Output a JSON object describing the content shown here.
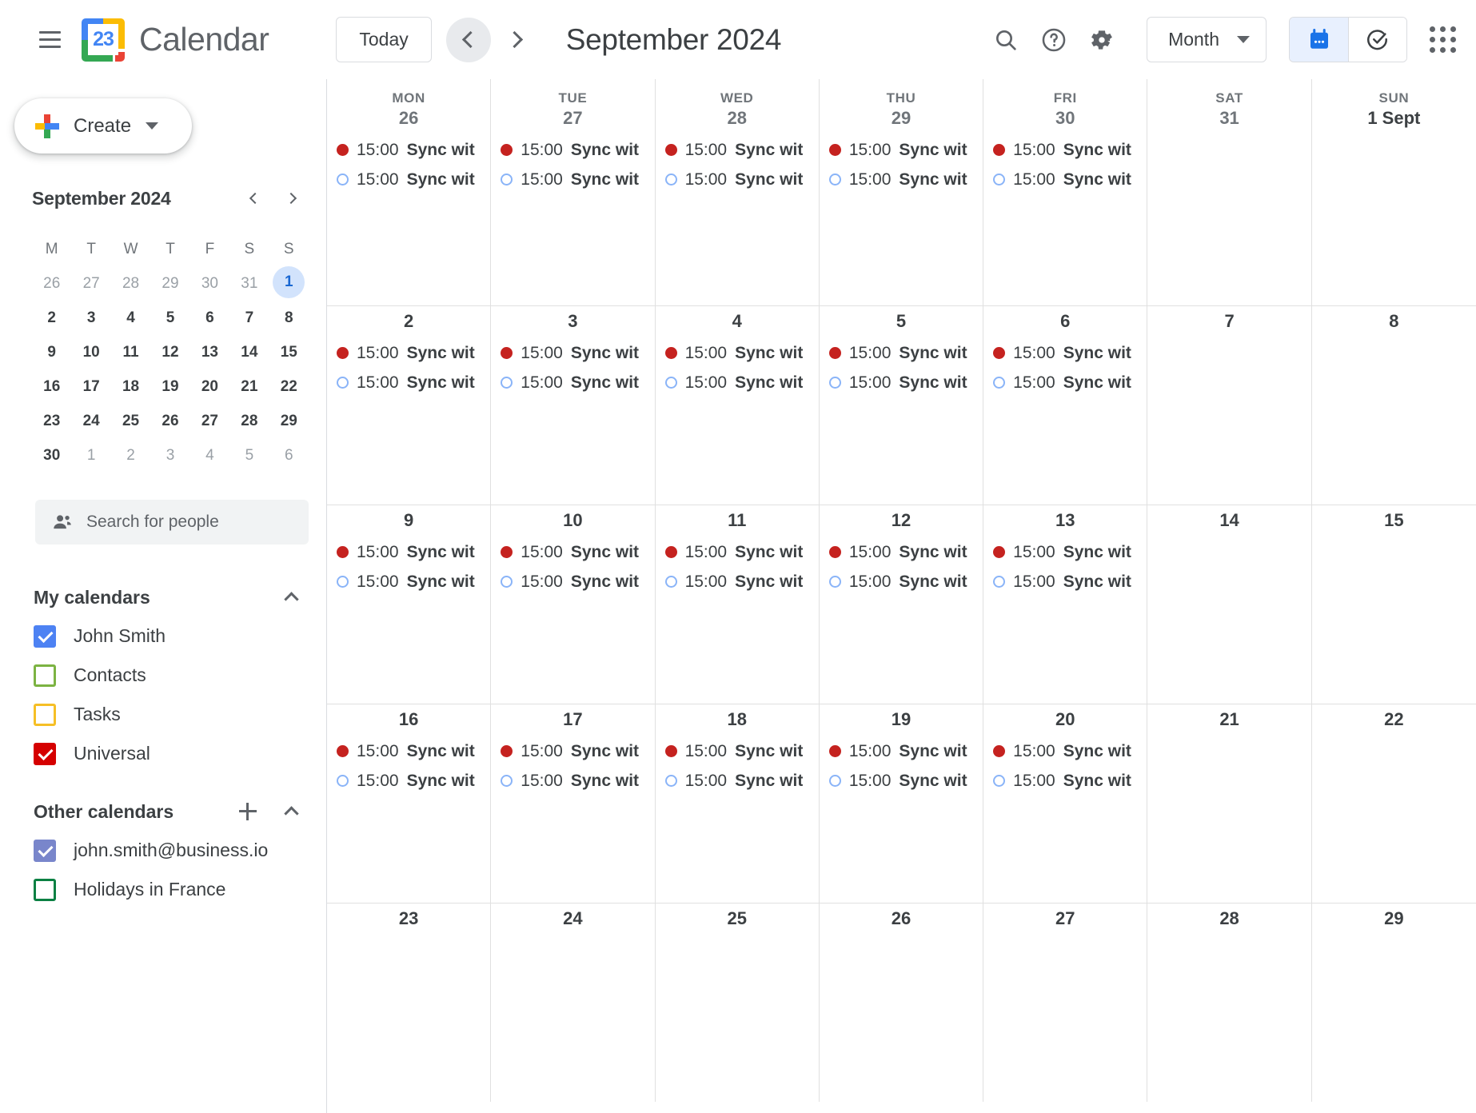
{
  "app": {
    "brand_title": "Calendar",
    "logo_day": "23"
  },
  "toolbar": {
    "menu_icon": "hamburger-menu-icon",
    "today_label": "Today",
    "prev_label": "chevron-left-icon",
    "next_label": "chevron-right-icon",
    "period_title": "September 2024",
    "search_icon": "search-icon",
    "help_icon": "help-circle-icon",
    "settings_icon": "gear-icon",
    "view_label": "Month",
    "calendar_toggle_icon": "calendar-icon",
    "tasks_toggle_icon": "check-circle-icon",
    "apps_icon": "apps-grid-icon"
  },
  "sidebar": {
    "create_label": "Create",
    "mini_calendar": {
      "title": "September 2024",
      "dow": [
        "M",
        "T",
        "W",
        "T",
        "F",
        "S",
        "S"
      ],
      "weeks": [
        [
          {
            "n": "26",
            "muted": true
          },
          {
            "n": "27",
            "muted": true
          },
          {
            "n": "28",
            "muted": true
          },
          {
            "n": "29",
            "muted": true
          },
          {
            "n": "30",
            "muted": true
          },
          {
            "n": "31",
            "muted": true
          },
          {
            "n": "1",
            "muted": false,
            "today": true
          }
        ],
        [
          {
            "n": "2"
          },
          {
            "n": "3"
          },
          {
            "n": "4"
          },
          {
            "n": "5"
          },
          {
            "n": "6"
          },
          {
            "n": "7"
          },
          {
            "n": "8"
          }
        ],
        [
          {
            "n": "9"
          },
          {
            "n": "10"
          },
          {
            "n": "11"
          },
          {
            "n": "12"
          },
          {
            "n": "13"
          },
          {
            "n": "14"
          },
          {
            "n": "15"
          }
        ],
        [
          {
            "n": "16"
          },
          {
            "n": "17"
          },
          {
            "n": "18"
          },
          {
            "n": "19"
          },
          {
            "n": "20"
          },
          {
            "n": "21"
          },
          {
            "n": "22"
          }
        ],
        [
          {
            "n": "23"
          },
          {
            "n": "24"
          },
          {
            "n": "25"
          },
          {
            "n": "26"
          },
          {
            "n": "27"
          },
          {
            "n": "28"
          },
          {
            "n": "29"
          }
        ],
        [
          {
            "n": "30"
          },
          {
            "n": "1",
            "muted": true
          },
          {
            "n": "2",
            "muted": true
          },
          {
            "n": "3",
            "muted": true
          },
          {
            "n": "4",
            "muted": true
          },
          {
            "n": "5",
            "muted": true
          },
          {
            "n": "6",
            "muted": true
          }
        ]
      ]
    },
    "people_search_placeholder": "Search for people",
    "my_calendars": {
      "title": "My calendars",
      "items": [
        {
          "label": "John Smith",
          "color": "#4d82f3",
          "checked": true
        },
        {
          "label": "Contacts",
          "color": "#7cb342",
          "checked": false
        },
        {
          "label": "Tasks",
          "color": "#f6bf26",
          "checked": false
        },
        {
          "label": "Universal",
          "color": "#d50000",
          "checked": true
        }
      ]
    },
    "other_calendars": {
      "title": "Other calendars",
      "items": [
        {
          "label": "john.smith@business.io",
          "color": "#7986cb",
          "checked": true
        },
        {
          "label": "Holidays in France",
          "color": "#0b8043",
          "checked": false
        }
      ]
    }
  },
  "calendar_grid": {
    "day_headers": [
      "MON",
      "TUE",
      "WED",
      "THU",
      "FRI",
      "SAT",
      "SUN"
    ],
    "event_time": "15:00",
    "event_title": "Sync wit",
    "weeks": [
      {
        "days": [
          {
            "num": "26",
            "muted": true,
            "events": [
              {
                "style": "filled"
              },
              {
                "style": "hollow"
              }
            ]
          },
          {
            "num": "27",
            "muted": true,
            "events": [
              {
                "style": "filled"
              },
              {
                "style": "hollow"
              }
            ]
          },
          {
            "num": "28",
            "muted": true,
            "events": [
              {
                "style": "filled"
              },
              {
                "style": "hollow"
              }
            ]
          },
          {
            "num": "29",
            "muted": true,
            "events": [
              {
                "style": "filled"
              },
              {
                "style": "hollow"
              }
            ]
          },
          {
            "num": "30",
            "muted": true,
            "events": [
              {
                "style": "filled"
              },
              {
                "style": "hollow"
              }
            ]
          },
          {
            "num": "31",
            "muted": true,
            "events": []
          },
          {
            "num": "1 Sept",
            "muted": false,
            "events": []
          }
        ]
      },
      {
        "days": [
          {
            "num": "2",
            "events": [
              {
                "style": "filled"
              },
              {
                "style": "hollow"
              }
            ]
          },
          {
            "num": "3",
            "events": [
              {
                "style": "filled"
              },
              {
                "style": "hollow"
              }
            ]
          },
          {
            "num": "4",
            "events": [
              {
                "style": "filled"
              },
              {
                "style": "hollow"
              }
            ]
          },
          {
            "num": "5",
            "events": [
              {
                "style": "filled"
              },
              {
                "style": "hollow"
              }
            ]
          },
          {
            "num": "6",
            "events": [
              {
                "style": "filled"
              },
              {
                "style": "hollow"
              }
            ]
          },
          {
            "num": "7",
            "events": []
          },
          {
            "num": "8",
            "events": []
          }
        ]
      },
      {
        "days": [
          {
            "num": "9",
            "events": [
              {
                "style": "filled"
              },
              {
                "style": "hollow"
              }
            ]
          },
          {
            "num": "10",
            "events": [
              {
                "style": "filled"
              },
              {
                "style": "hollow"
              }
            ]
          },
          {
            "num": "11",
            "events": [
              {
                "style": "filled"
              },
              {
                "style": "hollow"
              }
            ]
          },
          {
            "num": "12",
            "events": [
              {
                "style": "filled"
              },
              {
                "style": "hollow"
              }
            ]
          },
          {
            "num": "13",
            "events": [
              {
                "style": "filled"
              },
              {
                "style": "hollow"
              }
            ]
          },
          {
            "num": "14",
            "events": []
          },
          {
            "num": "15",
            "events": []
          }
        ]
      },
      {
        "days": [
          {
            "num": "16",
            "events": [
              {
                "style": "filled"
              },
              {
                "style": "hollow"
              }
            ]
          },
          {
            "num": "17",
            "events": [
              {
                "style": "filled"
              },
              {
                "style": "hollow"
              }
            ]
          },
          {
            "num": "18",
            "events": [
              {
                "style": "filled"
              },
              {
                "style": "hollow"
              }
            ]
          },
          {
            "num": "19",
            "events": [
              {
                "style": "filled"
              },
              {
                "style": "hollow"
              }
            ]
          },
          {
            "num": "20",
            "events": [
              {
                "style": "filled"
              },
              {
                "style": "hollow"
              }
            ]
          },
          {
            "num": "21",
            "events": []
          },
          {
            "num": "22",
            "events": []
          }
        ]
      },
      {
        "days": [
          {
            "num": "23",
            "events": []
          },
          {
            "num": "24",
            "events": []
          },
          {
            "num": "25",
            "events": []
          },
          {
            "num": "26",
            "events": []
          },
          {
            "num": "27",
            "events": []
          },
          {
            "num": "28",
            "events": []
          },
          {
            "num": "29",
            "events": []
          }
        ]
      }
    ]
  }
}
